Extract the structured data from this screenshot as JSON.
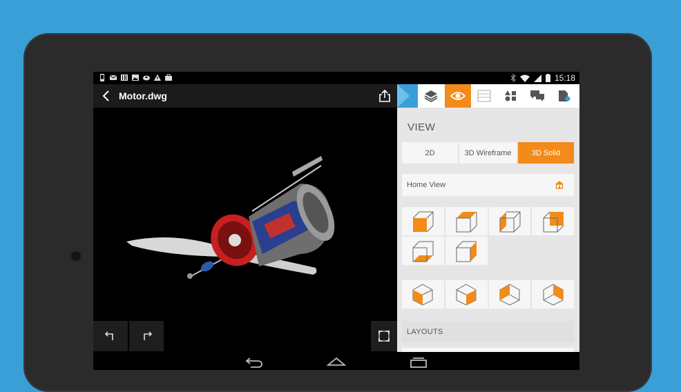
{
  "statusbar": {
    "time": "15:18",
    "left_icons": [
      "phone-icon",
      "mail-icon",
      "barcode-icon",
      "image-icon",
      "cloud-upload-icon",
      "warning-icon",
      "bag-icon"
    ],
    "right_icons": [
      "bluetooth-icon",
      "wifi-icon",
      "signal-icon",
      "battery-icon"
    ]
  },
  "appbar": {
    "title": "Motor.dwg"
  },
  "panel": {
    "tabs": [
      "layers-icon",
      "eye-icon",
      "properties-icon",
      "shapes-icon",
      "comments-icon",
      "file-settings-icon"
    ],
    "active_tab": "eye-icon",
    "accent_color": "#f28b1a",
    "brand_color": "#3a9fd6",
    "view_heading": "VIEW",
    "view_modes": [
      "2D",
      "3D Wireframe",
      "3D Solid"
    ],
    "active_mode": "3D Solid",
    "home_view_label": "Home View",
    "layouts_heading": "LAYOUTS"
  }
}
